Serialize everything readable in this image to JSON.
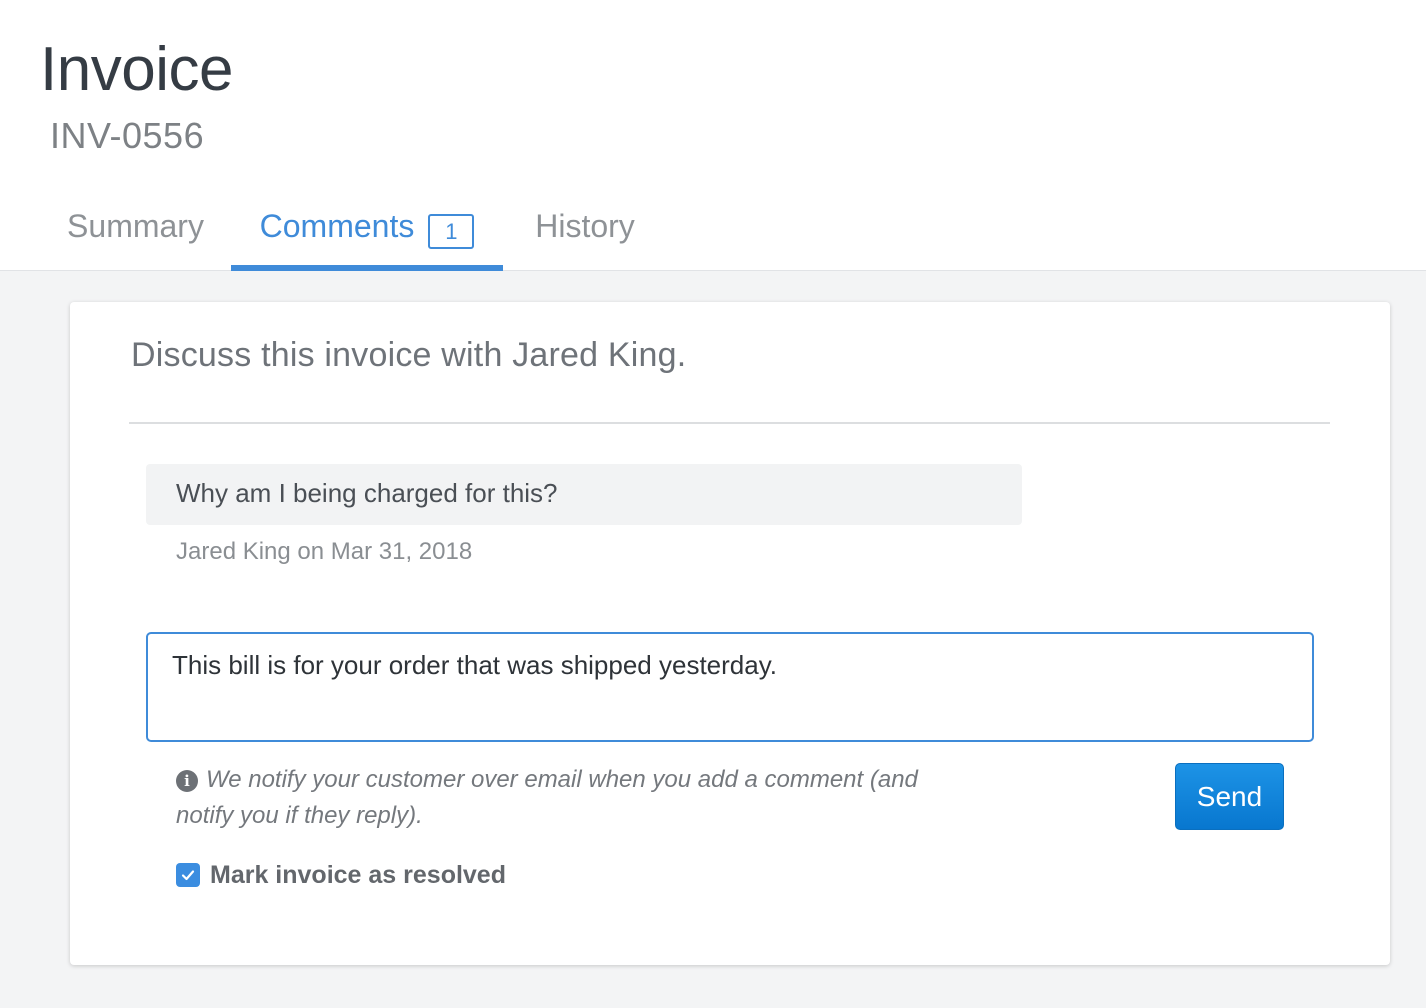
{
  "header": {
    "title": "Invoice",
    "invoice_number": "INV-0556"
  },
  "tabs": [
    {
      "label": "Summary",
      "active": false
    },
    {
      "label": "Comments",
      "count": "1",
      "active": true
    },
    {
      "label": "History",
      "active": false
    }
  ],
  "comments_panel": {
    "heading": "Discuss this invoice with Jared King.",
    "thread": [
      {
        "text": "Why am I being charged for this?",
        "meta": "Jared King on Mar 31, 2018"
      }
    ],
    "reply": {
      "value": "This bill is for your order that was shipped yesterday."
    },
    "notice": "We notify your customer over email when you add a comment (and notify you if they reply).",
    "send_label": "Send",
    "resolve": {
      "label": "Mark invoice as resolved",
      "checked": true
    }
  },
  "colors": {
    "accent": "#3f8bd9",
    "send": "#0a84db"
  },
  "icons": {
    "notice": "info-icon",
    "check": "checkmark-icon"
  }
}
